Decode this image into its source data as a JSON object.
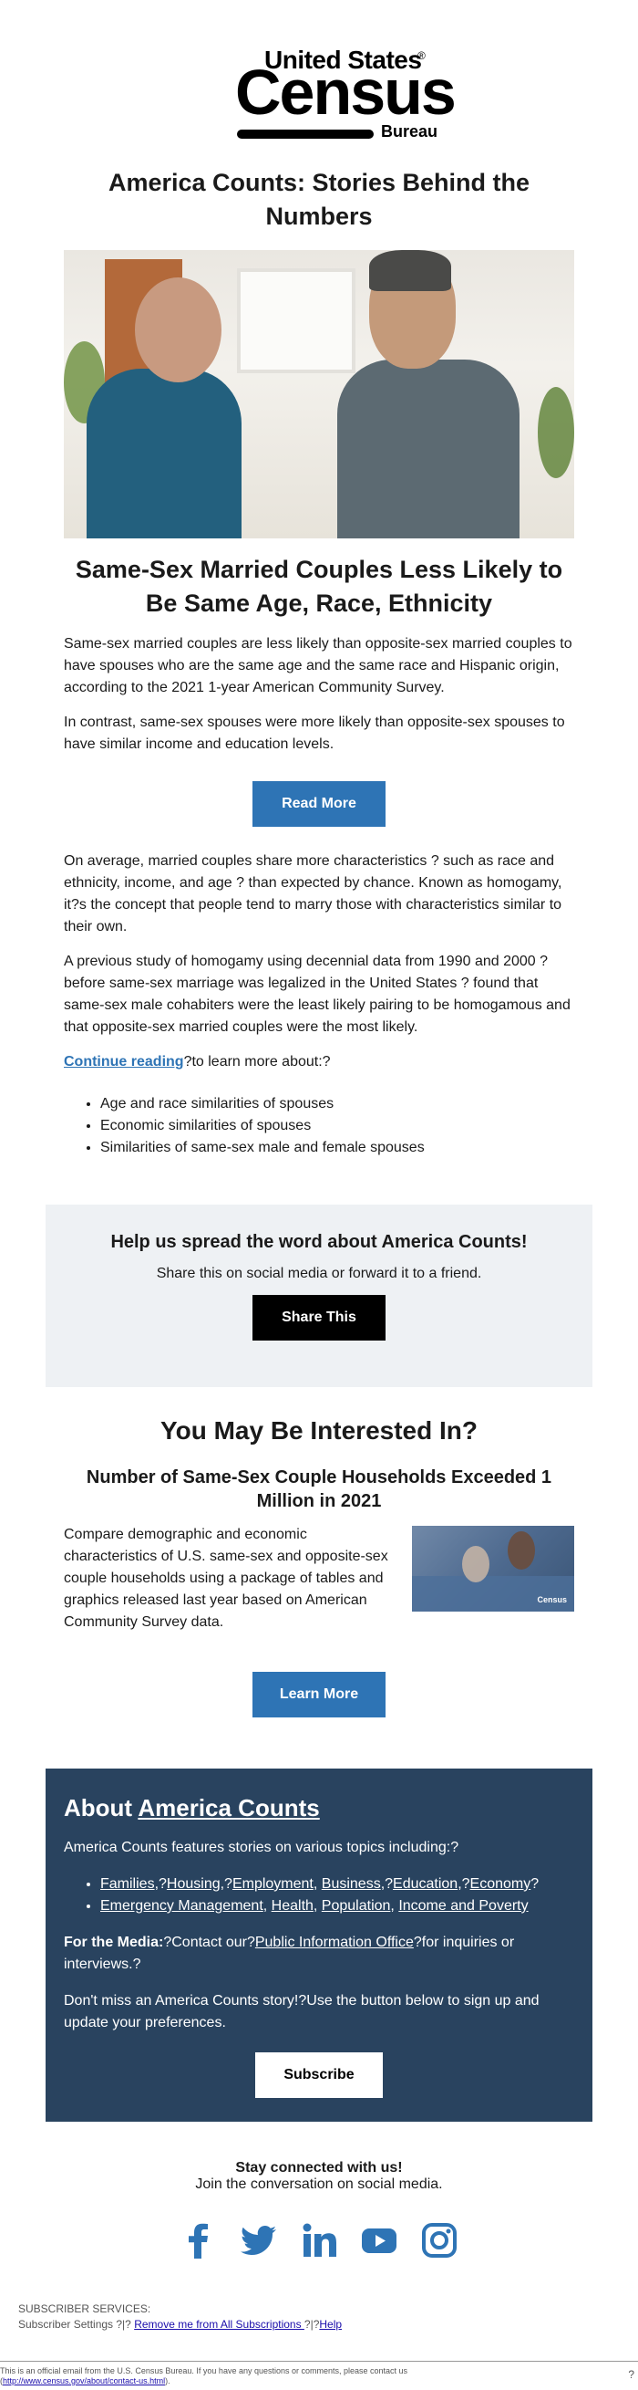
{
  "logo": {
    "line1": "United States",
    "registered": "®",
    "line2": "Census",
    "line3": "Bureau"
  },
  "header": {
    "title": "America Counts: Stories Behind the Numbers"
  },
  "hero_image": {
    "alt": "Two men talking in a kitchen"
  },
  "story": {
    "title": "Same-Sex Married Couples Less Likely to Be Same Age, Race, Ethnicity",
    "paragraphs": [
      "Same-sex married couples are less likely than opposite-sex married couples to have spouses who are the same age and the same race and Hispanic origin, according to the 2021 1-year American Community Survey.",
      "In contrast, same-sex spouses were more likely than opposite-sex spouses to have similar income and education levels."
    ],
    "read_more_label": "Read More",
    "more_paragraphs": [
      "On average, married couples share more characteristics ? such as race and ethnicity, income, and age ? than expected by chance. Known as homogamy, it?s the concept that people tend to marry those with characteristics similar to their own.",
      "A previous study of homogamy using decennial data from 1990 and 2000 ? before same-sex marriage was legalized in the United States ? found that same-sex male cohabiters were the least likely pairing to be homogamous and that opposite-sex married couples were the most likely."
    ],
    "continue_link": "Continue reading",
    "continue_suffix": "?to learn more about:?",
    "bullets": [
      "Age and race similarities of spouses",
      "Economic similarities of spouses",
      "Similarities of same-sex male and female spouses"
    ]
  },
  "share": {
    "heading": "Help us spread the word about America Counts!",
    "text": "Share this on social media or forward it to a friend.",
    "button_label": "Share This"
  },
  "interest": {
    "heading": "You May Be Interested In?",
    "item_title": "Number of Same-Sex Couple Households Exceeded 1 Million in 2021",
    "item_text": "Compare demographic and economic characteristics of U.S. same-sex and opposite-sex couple households using a package of tables and graphics released last year based on American Community Survey data.",
    "image_mark": "Census",
    "button_label": "Learn More"
  },
  "about": {
    "heading_prefix": "About ",
    "heading_link": "America Counts",
    "intro": "America Counts features stories on various topics including:?",
    "topics_row1": [
      {
        "label": "Families",
        "sep": ",?"
      },
      {
        "label": "Housing",
        "sep": ",?"
      },
      {
        "label": "Employment",
        "sep": ", "
      },
      {
        "label": "Business",
        "sep": ",?"
      },
      {
        "label": "Education",
        "sep": ",?"
      },
      {
        "label": "Economy",
        "sep": "?"
      }
    ],
    "topics_row2": [
      {
        "label": "Emergency Management",
        "sep": ", "
      },
      {
        "label": "Health",
        "sep": ", "
      },
      {
        "label": "Population",
        "sep": ", "
      },
      {
        "label": "Income and Poverty",
        "sep": ""
      }
    ],
    "media_label": "For the Media:",
    "media_pre": "?Contact our?",
    "media_link": "Public Information Office",
    "media_post": "?for inquiries or interviews.?",
    "signup_text": "Don't miss an America Counts story!?Use the button below to sign up and update your preferences.",
    "subscribe_label": "Subscribe"
  },
  "social": {
    "stay": "Stay connected with us!",
    "join": "Join the conversation on social media.",
    "icon_color": "#2e74b5",
    "icons": [
      "facebook-icon",
      "twitter-icon",
      "linkedin-icon",
      "youtube-icon",
      "instagram-icon"
    ]
  },
  "subscriber": {
    "heading": "SUBSCRIBER SERVICES:",
    "settings": "Subscriber Settings ?|? ",
    "remove_link": "Remove me from All Subscriptions ",
    "sep": "?|?",
    "help_link": "Help"
  },
  "footer": {
    "note": "This is an official email from the U.S. Census Bureau. If you have any questions or comments, please contact us",
    "url": "http://www.census.gov/about/contact-us.html",
    "trailing": "?"
  },
  "colors": {
    "accent": "#2e74b5",
    "about_bg": "#29435f",
    "share_bg": "#eef1f4"
  }
}
